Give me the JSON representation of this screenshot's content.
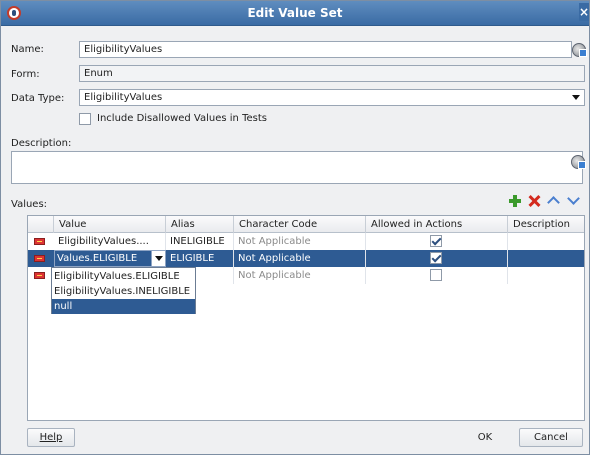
{
  "window": {
    "title": "Edit Value Set"
  },
  "form": {
    "name_label": "Name:",
    "name_value": "EligibilityValues",
    "form_label": "Form:",
    "form_value": "Enum",
    "datatype_label": "Data Type:",
    "datatype_value": "EligibilityValues",
    "include_disallowed_label": "Include Disallowed Values in Tests",
    "include_disallowed_checked": false,
    "description_label": "Description:",
    "description_value": ""
  },
  "values": {
    "label": "Values:",
    "toolbar": [
      "add-icon",
      "delete-icon",
      "move-up-icon",
      "move-down-icon"
    ],
    "columns": [
      "Value",
      "Alias",
      "Character Code",
      "Allowed in Actions",
      "Description"
    ],
    "rows": [
      {
        "value": "EligibilityValues....",
        "alias": "INELIGIBLE",
        "char_code": "Not Applicable",
        "allowed": true,
        "description": ""
      },
      {
        "value": "Values.ELIGIBLE",
        "alias": "ELIGIBLE",
        "char_code": "Not Applicable",
        "allowed": true,
        "description": ""
      },
      {
        "value": "",
        "alias": "",
        "char_code": "Not Applicable",
        "allowed": false,
        "description": ""
      }
    ],
    "dropdown_options": [
      "EligibilityValues.ELIGIBLE",
      "EligibilityValues.INELIGIBLE",
      "null"
    ],
    "dropdown_selected": "null"
  },
  "buttons": {
    "help": "Help",
    "ok": "OK",
    "cancel": "Cancel"
  },
  "colors": {
    "title_bar": "#3a6ba4",
    "selection": "#2e5b93",
    "add": "#3b9a2c",
    "delete": "#d32a1e",
    "move": "#4b7fcf"
  }
}
